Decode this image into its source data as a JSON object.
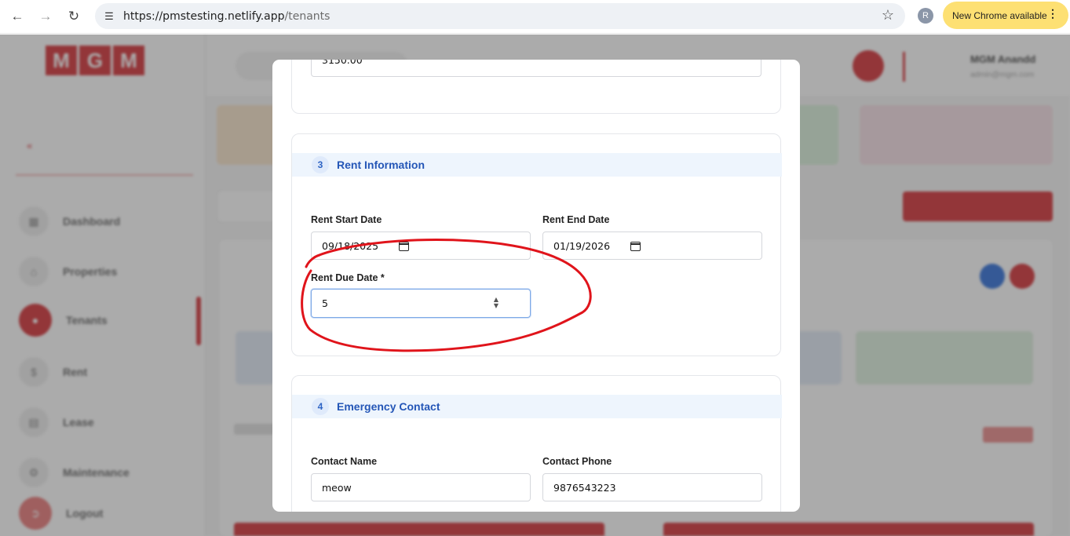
{
  "browser": {
    "url_host": "https://pmstesting.netlify.app",
    "url_path": "/tenants",
    "profile_initial": "R",
    "update_label": "New Chrome available"
  },
  "background_app": {
    "logo_letters": [
      "M",
      "G",
      "M"
    ],
    "sidebar_items": [
      "Dashboard",
      "Properties",
      "Tenants",
      "Rent",
      "Lease",
      "Maintenance",
      "Logout"
    ],
    "user_name": "MGM Anandd",
    "user_email": "admin@mgm.com"
  },
  "modal": {
    "prev_section": {
      "value": "3150.00"
    },
    "rent_section": {
      "number": "3",
      "title": "Rent Information",
      "start_label": "Rent Start Date",
      "start_value": "09/18/2025",
      "end_label": "Rent End Date",
      "end_value": "01/19/2026",
      "due_label": "Rent Due Date *",
      "due_value": "5"
    },
    "emergency_section": {
      "number": "4",
      "title": "Emergency Contact",
      "name_label": "Contact Name",
      "name_value": "meow",
      "phone_label": "Contact Phone",
      "phone_value": "9876543223"
    }
  },
  "colors": {
    "brand_red": "#d11f25",
    "section_header_bg": "#eef5fd",
    "section_title": "#2456b7",
    "annotation": "#e0141b",
    "chrome_pill": "#fde073"
  },
  "icons": {
    "back": "arrow-left-icon",
    "forward": "arrow-right-icon",
    "reload": "reload-icon",
    "site_settings": "tune-icon",
    "bookmark": "star-icon",
    "menu": "more-vert-icon",
    "calendar": "calendar-icon",
    "spinner": "spinner-icon"
  }
}
